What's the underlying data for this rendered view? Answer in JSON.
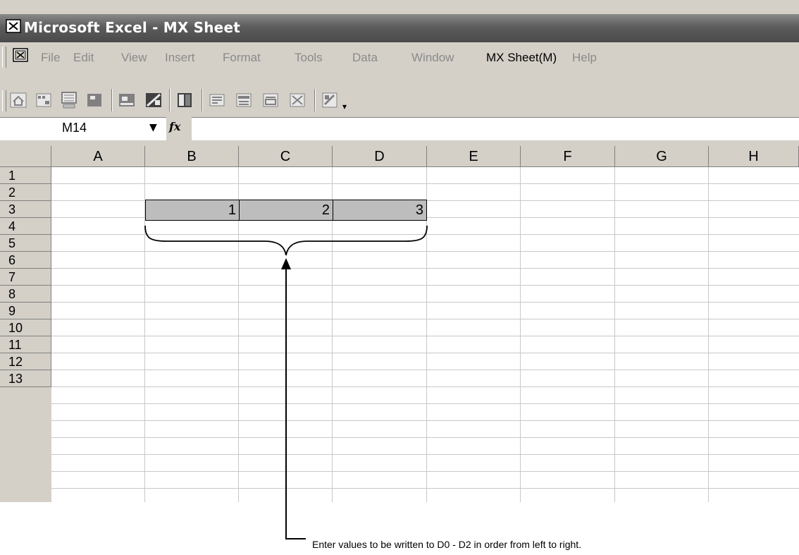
{
  "window": {
    "title": "Microsoft Excel - MX Sheet"
  },
  "menu": {
    "items": [
      "File",
      "Edit",
      "View",
      "Insert",
      "Format",
      "Tools",
      "Data",
      "Window",
      "MX Sheet(M)",
      "Help"
    ]
  },
  "formula_bar": {
    "name_box": "M14",
    "fx_label": "fx",
    "formula": ""
  },
  "sheet": {
    "columns": [
      "A",
      "B",
      "C",
      "D",
      "E",
      "F",
      "G",
      "H"
    ],
    "rows": [
      "1",
      "2",
      "3",
      "4",
      "5",
      "6",
      "7",
      "8",
      "9",
      "10",
      "11",
      "12",
      "13"
    ],
    "values": {
      "B2": "1",
      "C2": "2",
      "D2": "3"
    }
  },
  "annotation": {
    "text": "Enter values to be written to D0 - D2  in order from left to right."
  }
}
